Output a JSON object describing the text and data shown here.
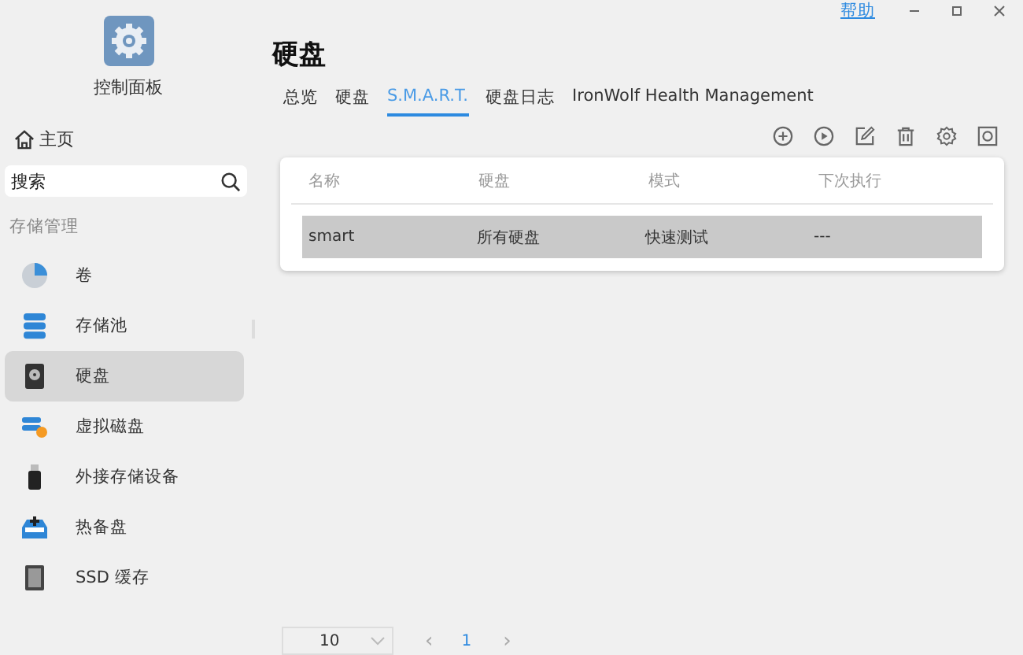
{
  "top_bar": {
    "help_link": "帮助"
  },
  "sidebar": {
    "app_title": "控制面板",
    "home": "主页",
    "search": {
      "placeholder": "搜索"
    },
    "section_label": "存储管理",
    "items": [
      {
        "label": "卷",
        "kind": "volume",
        "selected": false
      },
      {
        "label": "存储池",
        "kind": "pool",
        "selected": false
      },
      {
        "label": "硬盘",
        "kind": "disk",
        "selected": true
      },
      {
        "label": "虚拟磁盘",
        "kind": "virtual",
        "selected": false
      },
      {
        "label": "外接存储设备",
        "kind": "external",
        "selected": false
      },
      {
        "label": "热备盘",
        "kind": "spare",
        "selected": false
      },
      {
        "label": "SSD 缓存",
        "kind": "cache",
        "selected": false
      }
    ]
  },
  "page_title": "硬盘",
  "tabs": [
    {
      "label": "总览",
      "selected": false
    },
    {
      "label": "硬盘",
      "selected": false
    },
    {
      "label": "S.M.A.R.T.",
      "selected": true
    },
    {
      "label": "硬盘日志",
      "selected": false
    },
    {
      "label": "IronWolf Health Management",
      "selected": false
    }
  ],
  "table": {
    "columns": [
      "名称",
      "硬盘",
      "模式",
      "下次执行"
    ],
    "rows": [
      {
        "cells": [
          "smart",
          "所有硬盘",
          "快速测试",
          "---"
        ],
        "selected": true
      }
    ]
  },
  "pagination": {
    "page_size": "10",
    "prev": "‹",
    "current_page": "1",
    "next": "›"
  }
}
